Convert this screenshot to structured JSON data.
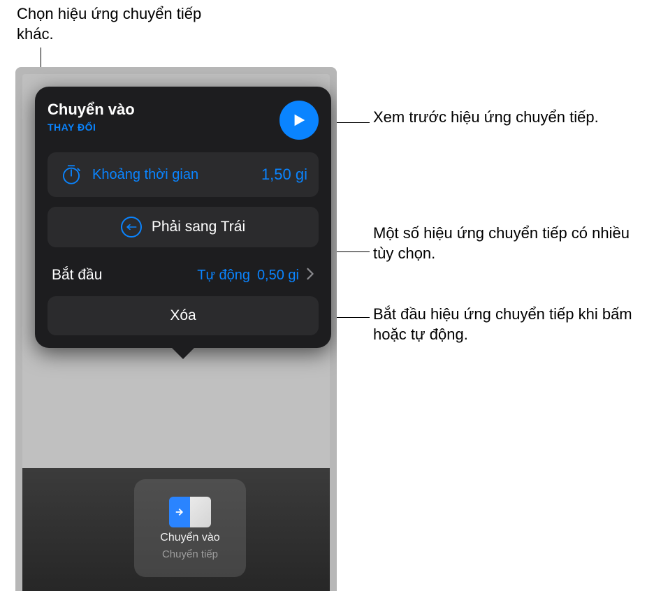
{
  "popover": {
    "title": "Chuyển vào",
    "change": "THAY ĐỔI",
    "duration_label": "Khoảng thời gian",
    "duration_value": "1,50 gi",
    "direction_label": "Phải sang Trái",
    "start_label": "Bắt đầu",
    "start_mode": "Tự động",
    "start_delay": "0,50 gi",
    "delete": "Xóa"
  },
  "thumbnail": {
    "label": "Chuyển vào",
    "sublabel": "Chuyển tiếp"
  },
  "callouts": {
    "top": "Chọn hiệu ứng chuyển tiếp khác.",
    "preview": "Xem trước hiệu ứng chuyển tiếp.",
    "options": "Một số hiệu ứng chuyển tiếp có nhiều tùy chọn.",
    "start": "Bắt đầu hiệu ứng chuyển tiếp khi bấm hoặc tự động."
  }
}
